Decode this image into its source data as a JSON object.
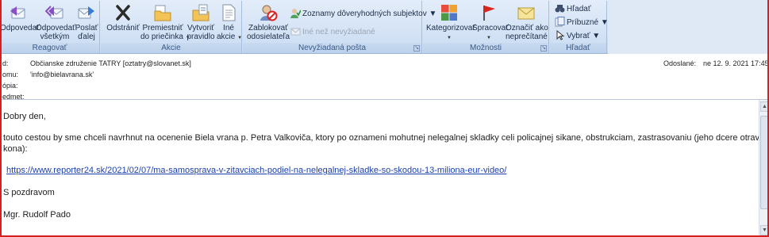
{
  "ribbon": {
    "reply_group": {
      "caption": "Reagovať",
      "reply": "Odpovedať",
      "reply_all_1": "Odpovedať",
      "reply_all_2": "všetkým",
      "forward_1": "Poslať",
      "forward_2": "ďalej"
    },
    "actions_group": {
      "caption": "Akcie",
      "delete": "Odstrániť",
      "move_1": "Premiestniť",
      "move_2": "do priečinka",
      "rule_1": "Vytvoriť",
      "rule_2": "pravidlo",
      "other_1": "Iné",
      "other_2": "akcie"
    },
    "junk_group": {
      "caption": "Nevyžiadaná pošta",
      "block_1": "Zablokovať",
      "block_2": "odosielateľa",
      "safe_lists": "Zoznamy dôveryhodných subjektov",
      "not_junk": "Iné než nevyžiadané"
    },
    "options_group": {
      "caption": "Možnosti",
      "categorize": "Kategorizovať",
      "follow_up": "Spracovať",
      "mark_unread_1": "Označiť ako",
      "mark_unread_2": "neprečítané"
    },
    "find_group": {
      "caption": "Hľadať",
      "find": "Hľadať",
      "related": "Príbuzné",
      "select": "Vybrať"
    }
  },
  "header": {
    "from_label": "d:",
    "from_value": "Občianske združenie TATRY [oztatry@slovanet.sk]",
    "to_label": "omu:",
    "to_value": "'info@bielavrana.sk'",
    "cc_label": "ópia:",
    "subject_label": "edmet:",
    "sent_label": "Odoslané:",
    "sent_value": "ne 12. 9. 2021 17:45"
  },
  "message": {
    "greeting": "Dobry den,",
    "line1": "touto cestou by sme chceli navrhnut na ocenenie Biela vrana p. Petra Valkoviča, ktory po oznameni mohutnej nelegalnej  skladky celi policajnej sikane, obstrukciam, zastrasovaniu (jeho dcere otravili",
    "line2": "kona):",
    "link": "https://www.reporter24.sk/2021/02/07/ma-samosprava-v-zitavciach-podiel-na-nelegalnej-skladke-so-skodou-13-miliona-eur-video/",
    "closing": "S pozdravom",
    "signature": "Mgr. Rudolf Pado"
  },
  "icons": {
    "reply": "reply-icon",
    "reply_all": "reply-all-icon",
    "forward": "forward-icon",
    "delete": "delete-x-icon",
    "move": "folder-move-icon",
    "rule": "rule-icon",
    "other": "document-icon",
    "block": "block-sender-icon",
    "safe": "safe-list-icon",
    "categorize": "color-categories-icon",
    "flag": "red-flag-icon",
    "unread": "envelope-icon",
    "find": "binoculars-icon"
  },
  "colors": {
    "frame": "#d42020",
    "link": "#1c3fae",
    "ribbon": "#d6e4f6"
  }
}
